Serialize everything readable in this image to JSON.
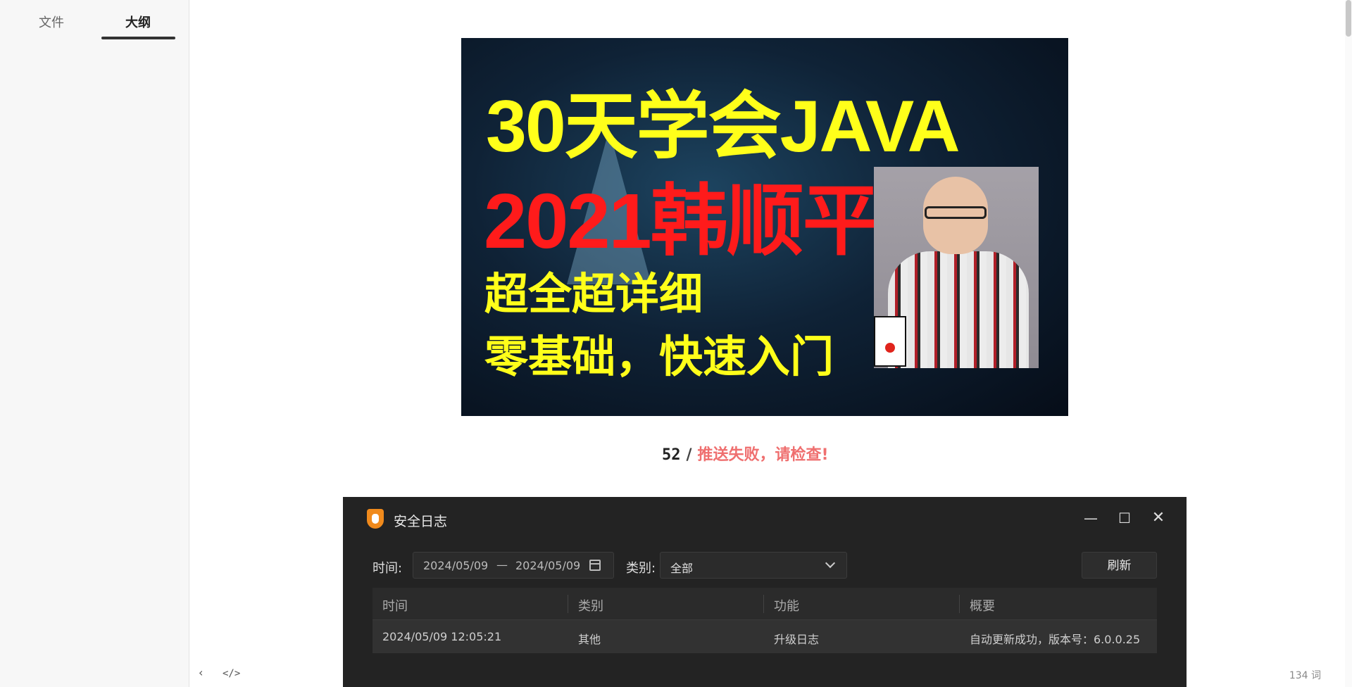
{
  "sidebar": {
    "tabs": [
      {
        "label": "文件"
      },
      {
        "label": "大纲"
      }
    ]
  },
  "banner": {
    "line1": "30天学会JAVA",
    "line2": "2021韩顺平",
    "line3": "超全超详细",
    "line4": "零基础，快速入门"
  },
  "caption": {
    "number": "52",
    "separator": "/",
    "message": "推送失败，请检查!"
  },
  "footer": {
    "back_icon": "chevron-left-icon",
    "code_icon": "code-icon",
    "back_glyph": "‹",
    "code_glyph": "</>",
    "word_count": "134 词"
  },
  "log_window": {
    "title": "安全日志",
    "controls": {
      "minimize": "—",
      "maximize": "☐",
      "close": "✕"
    },
    "filters": {
      "time_label": "时间:",
      "date_start": "2024/05/09",
      "date_separator": "—",
      "date_end": "2024/05/09",
      "type_label": "类别:",
      "type_value": "全部",
      "refresh_label": "刷新"
    },
    "table": {
      "columns": [
        "时间",
        "类别",
        "功能",
        "概要"
      ],
      "rows": [
        [
          "2024/05/09 12:05:21",
          "其他",
          "升级日志",
          "自动更新成功，版本号：6.0.0.25"
        ]
      ]
    }
  },
  "colors": {
    "banner_yellow": "#ffff1a",
    "banner_red": "#ff1b1b",
    "error_text": "#ef6f6f",
    "window_bg": "#232323",
    "logo_orange": "#f08a1c"
  }
}
